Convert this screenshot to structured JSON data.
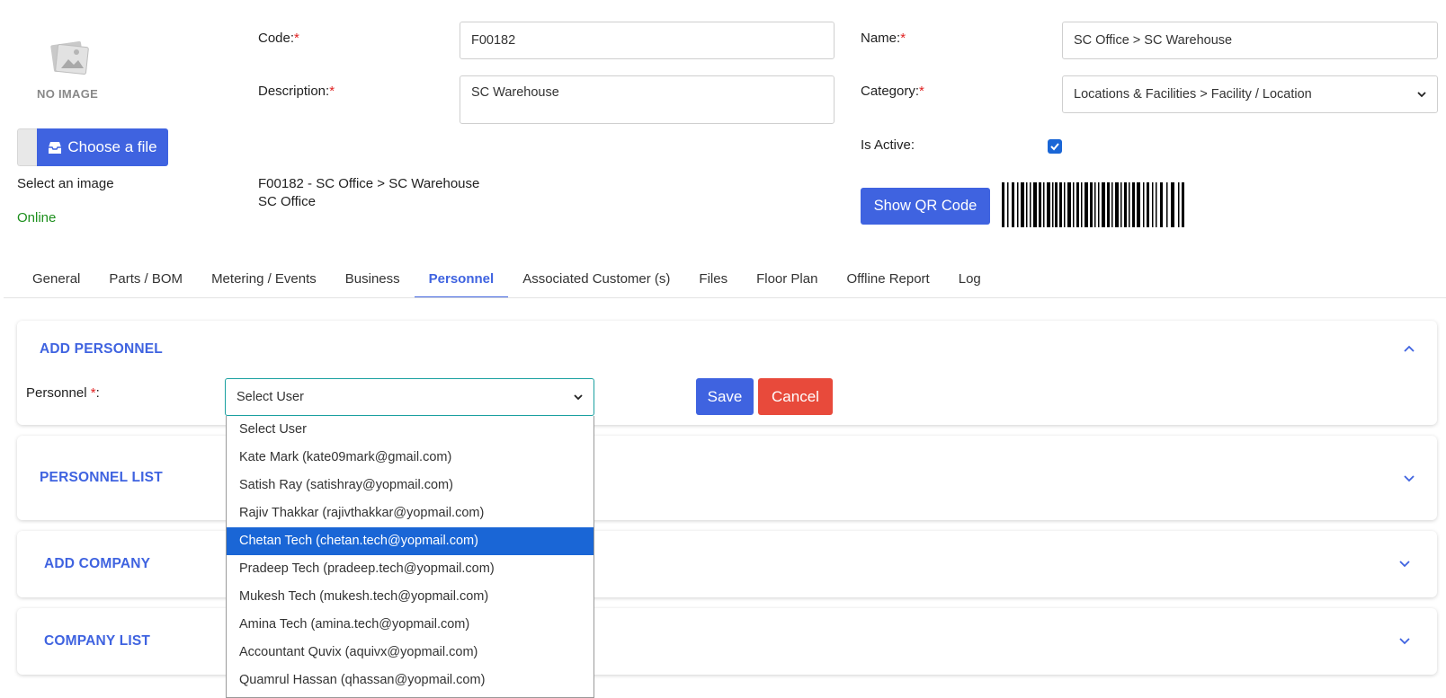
{
  "image_panel": {
    "no_image": "NO IMAGE",
    "choose_file": "Choose a file",
    "select_image": "Select an image",
    "status": "Online"
  },
  "form": {
    "code_label": "Code:",
    "code_value": "F00182",
    "description_label": "Description:",
    "description_value": "SC Warehouse",
    "name_label": "Name:",
    "name_value": "SC Office > SC Warehouse",
    "category_label": "Category:",
    "category_value": "Locations & Facilities > Facility / Location",
    "active_label": "Is Active:",
    "active_checked": true,
    "summary_line1": "F00182 - SC Office > SC Warehouse",
    "summary_line2": "SC Office",
    "required_mark": "*",
    "qr_button": "Show QR Code"
  },
  "tabs": [
    {
      "label": "General"
    },
    {
      "label": "Parts / BOM"
    },
    {
      "label": "Metering / Events"
    },
    {
      "label": "Business"
    },
    {
      "label": "Personnel",
      "active": true
    },
    {
      "label": "Associated Customer (s)"
    },
    {
      "label": "Files"
    },
    {
      "label": "Floor Plan"
    },
    {
      "label": "Offline Report"
    },
    {
      "label": "Log"
    }
  ],
  "panels": {
    "add_personnel": "ADD PERSONNEL",
    "personnel_list": "PERSONNEL LIST",
    "add_company": "ADD COMPANY",
    "company_list": "COMPANY LIST"
  },
  "personnel_form": {
    "label": "Personnel ",
    "label_suffix": ":",
    "selected": "Select User",
    "save": "Save",
    "cancel": "Cancel",
    "options": [
      "Select User",
      "Kate Mark (kate09mark@gmail.com)",
      "Satish Ray (satishray@yopmail.com)",
      "Rajiv Thakkar (rajivthakkar@yopmail.com)",
      "Chetan Tech (chetan.tech@yopmail.com)",
      "Pradeep Tech (pradeep.tech@yopmail.com)",
      "Mukesh Tech (mukesh.tech@yopmail.com)",
      "Amina Tech (amina.tech@yopmail.com)",
      "Accountant Quvix (aquivx@yopmail.com)",
      "Quamrul Hassan (qhassan@yopmail.com)"
    ],
    "highlighted_index": 4
  },
  "colors": {
    "accent": "#3f63e0",
    "danger": "#e84a3b",
    "success": "#1d8f1d",
    "highlight": "#1a66d6"
  }
}
